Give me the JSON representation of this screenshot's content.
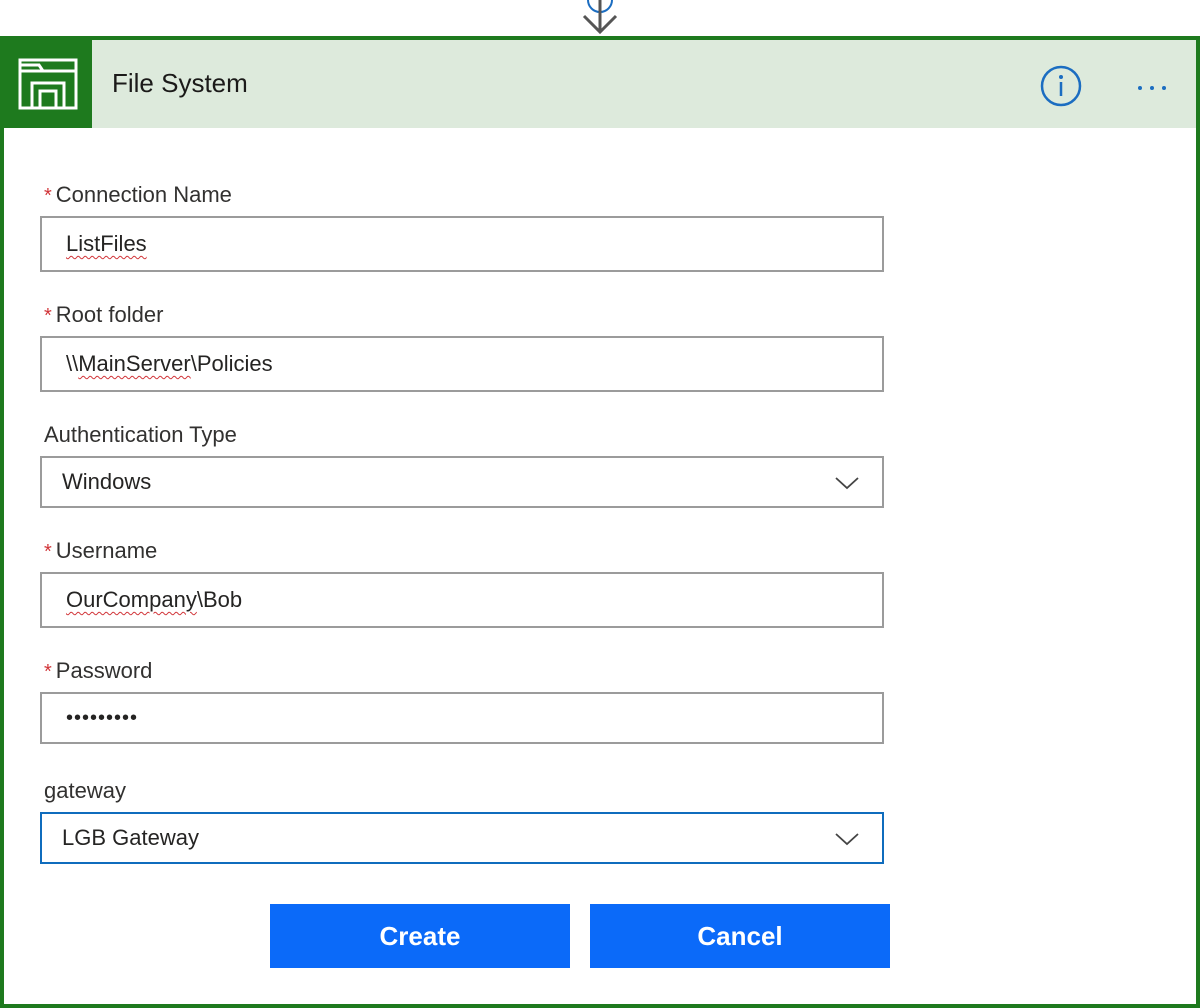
{
  "card": {
    "title": "File System",
    "app_icon": "folder-icon",
    "accent_color": "#1e7a1e",
    "header_bg": "#ddeadc"
  },
  "header_actions": {
    "info_icon": "info-icon",
    "more_icon": "ellipsis-icon"
  },
  "form": {
    "connection_name": {
      "label": "Connection Name",
      "required": "*",
      "value": "ListFiles",
      "misspelled": "ListFiles"
    },
    "root_folder": {
      "label": "Root folder",
      "required": "*",
      "prefix": "\\\\",
      "misspelled": "MainServer",
      "suffix": "\\Policies"
    },
    "auth_type": {
      "label": "Authentication Type",
      "value": "Windows"
    },
    "username": {
      "label": "Username",
      "required": "*",
      "misspelled": "OurCompany",
      "suffix": "\\Bob"
    },
    "password": {
      "label": "Password",
      "required": "*",
      "value": "•••••••••"
    },
    "gateway": {
      "label": "gateway",
      "value": "LGB Gateway"
    }
  },
  "buttons": {
    "create": "Create",
    "cancel": "Cancel",
    "color": "#0b6af9"
  }
}
